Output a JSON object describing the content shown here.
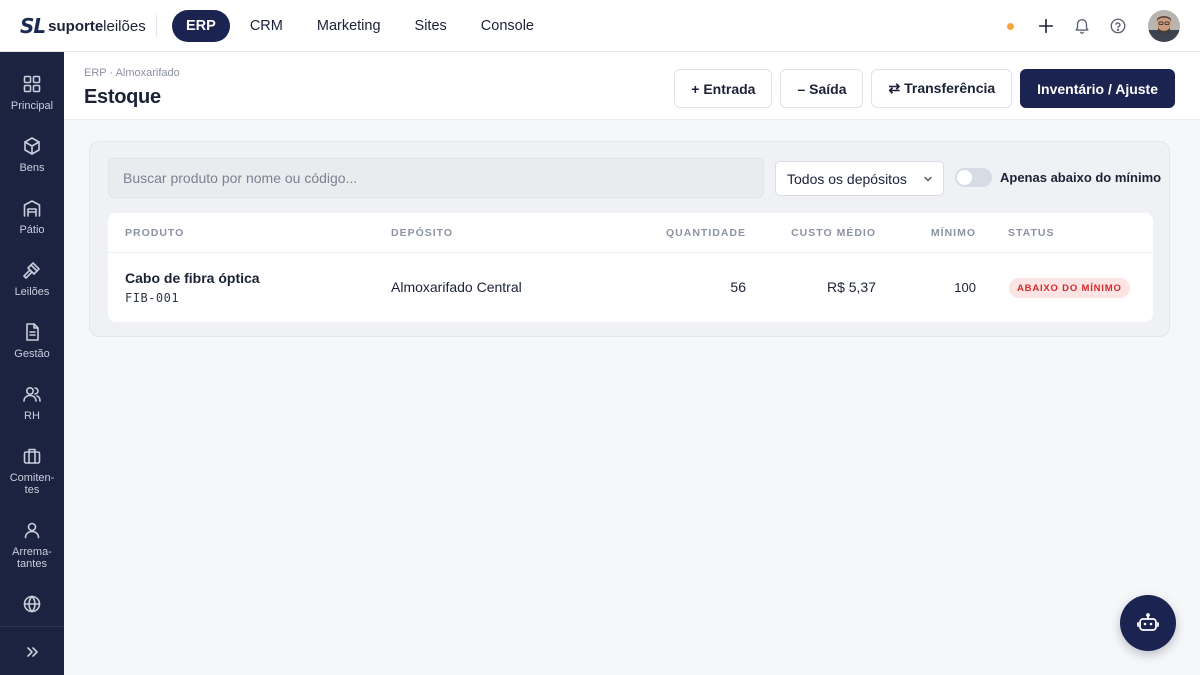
{
  "brand": {
    "mark": "SL",
    "name_bold": "suporte",
    "name_light": "leilões"
  },
  "topnav": [
    {
      "label": "ERP",
      "active": true
    },
    {
      "label": "CRM",
      "active": false
    },
    {
      "label": "Marketing",
      "active": false
    },
    {
      "label": "Sites",
      "active": false
    },
    {
      "label": "Console",
      "active": false
    }
  ],
  "sidebar": [
    {
      "label": "Principal",
      "icon": "grid-icon"
    },
    {
      "label": "Bens",
      "icon": "box-icon"
    },
    {
      "label": "Pátio",
      "icon": "warehouse-icon"
    },
    {
      "label": "Leilões",
      "icon": "gavel-icon"
    },
    {
      "label": "Gestão",
      "icon": "document-icon"
    },
    {
      "label": "RH",
      "icon": "users-icon"
    },
    {
      "label": "Comiten-\ntes",
      "icon": "briefcase-icon"
    },
    {
      "label": "Arrema-\ntantes",
      "icon": "user-icon"
    },
    {
      "label": "",
      "icon": "globe-icon"
    }
  ],
  "header": {
    "breadcrumb": "ERP · Almoxarifado",
    "title": "Estoque",
    "actions": {
      "entrada": "+ Entrada",
      "saida": "– Saída",
      "transferencia": "⇄ Transferência",
      "inventario": "Inventário / Ajuste"
    }
  },
  "filters": {
    "search_placeholder": "Buscar produto por nome ou código...",
    "search_value": "",
    "deposit_selected": "Todos os depósitos",
    "below_min_label": "Apenas abaixo do mínimo",
    "below_min_checked": false
  },
  "table": {
    "headers": {
      "produto": "PRODUTO",
      "deposito": "DEPÓSITO",
      "quantidade": "QUANTIDADE",
      "custo": "CUSTO MÉDIO",
      "minimo": "MÍNIMO",
      "status": "STATUS"
    },
    "rows": [
      {
        "name": "Cabo de fibra óptica",
        "code": "FIB-001",
        "deposit": "Almoxarifado Central",
        "quantity": "56",
        "cost": "R$ 5,37",
        "minimum": "100",
        "status": "ABAIXO DO MÍNIMO"
      }
    ]
  },
  "colors": {
    "navy": "#1b2450",
    "sidebar": "#1b2341",
    "status_bg": "#fde4e4",
    "status_text": "#d42a2a",
    "notification_dot": "#f3a73b"
  }
}
